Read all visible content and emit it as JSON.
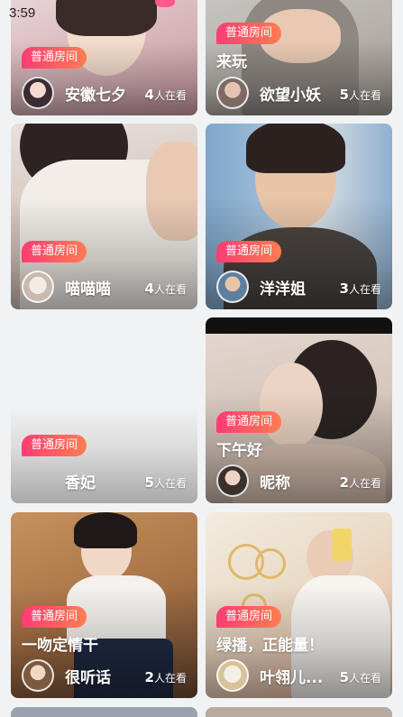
{
  "status_bar": {
    "time": "3:59"
  },
  "cards": [
    {
      "badge": "普通房间",
      "title": "",
      "host": "安徽七夕",
      "viewers": "4",
      "viewers_unit": "人在看"
    },
    {
      "badge": "普通房间",
      "title": "来玩",
      "host": "欲望小妖",
      "viewers": "5",
      "viewers_unit": "人在看"
    },
    {
      "badge": "普通房间",
      "title": "",
      "host": "喵喵喵",
      "viewers": "4",
      "viewers_unit": "人在看"
    },
    {
      "badge": "普通房间",
      "title": "",
      "host": "洋洋姐",
      "viewers": "3",
      "viewers_unit": "人在看"
    },
    {
      "badge": "普通房间",
      "title": "",
      "host": "香妃",
      "viewers": "5",
      "viewers_unit": "人在看"
    },
    {
      "badge": "普通房间",
      "title": "下午好",
      "host": "昵称",
      "viewers": "2",
      "viewers_unit": "人在看"
    },
    {
      "badge": "普通房间",
      "title": "一吻定情干",
      "host": "很听话",
      "viewers": "2",
      "viewers_unit": "人在看"
    },
    {
      "badge": "普通房间",
      "title": "绿播，正能量！",
      "host": "叶翎儿...",
      "viewers": "5",
      "viewers_unit": "人在看"
    }
  ]
}
